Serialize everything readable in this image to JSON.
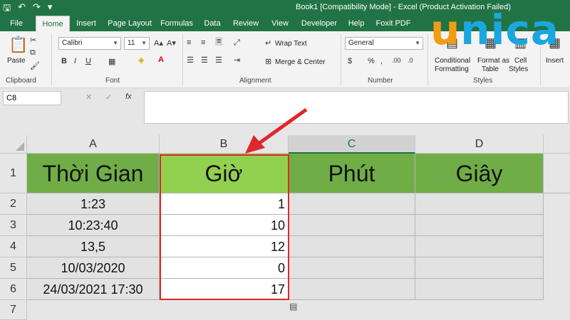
{
  "titlebar": {
    "title": "Book1  [Compatibility Mode]  -  Excel (Product Activation Failed)"
  },
  "tabs": [
    {
      "label": "File"
    },
    {
      "label": "Home"
    },
    {
      "label": "Insert"
    },
    {
      "label": "Page Layout"
    },
    {
      "label": "Formulas"
    },
    {
      "label": "Data"
    },
    {
      "label": "Review"
    },
    {
      "label": "View"
    },
    {
      "label": "Developer"
    },
    {
      "label": "Help"
    },
    {
      "label": "Foxit PDF"
    }
  ],
  "ribbon": {
    "paste": "Paste",
    "clipboard": "Clipboard",
    "font_name": "Calibri",
    "font_size": "11",
    "font": "Font",
    "wrap_text": "Wrap Text",
    "merge_center": "Merge & Center",
    "alignment": "Alignment",
    "number_format": "General",
    "number": "Number",
    "conditional": "Conditional",
    "formatting": "Formatting",
    "format_as": "Format as",
    "table": "Table",
    "cell": "Cell",
    "styles_btn": "Styles",
    "styles": "Styles",
    "insert": "Insert"
  },
  "formula_bar": {
    "name_box": "C8",
    "fx": "fx"
  },
  "columns": [
    "A",
    "B",
    "C",
    "D"
  ],
  "rows": [
    "1",
    "2",
    "3",
    "4",
    "5",
    "6",
    "7"
  ],
  "headers": {
    "a": "Thời Gian",
    "b": "Giờ",
    "c": "Phút",
    "d": "Giây"
  },
  "data": [
    {
      "time": "1:23",
      "hour": "1"
    },
    {
      "time": "10:23:40",
      "hour": "10"
    },
    {
      "time": "13,5",
      "hour": "12"
    },
    {
      "time": "10/03/2020",
      "hour": "0"
    },
    {
      "time": "24/03/2021 17:30",
      "hour": "17"
    }
  ],
  "logo": {
    "brand": "unica"
  },
  "colors": {
    "excel_green": "#217346",
    "header_green": "#70ad47",
    "highlight_red": "#e0272a"
  }
}
